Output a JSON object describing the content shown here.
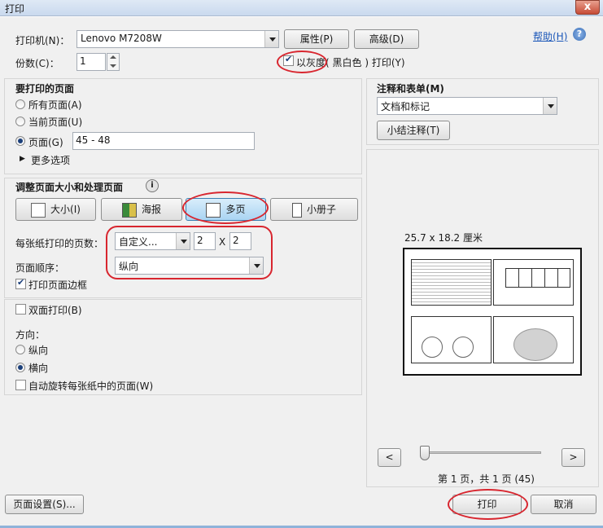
{
  "window": {
    "title": "打印",
    "close": "x"
  },
  "printer": {
    "printer_label": "打印机(N)：",
    "printer_value": "Lenovo M7208W",
    "properties_button": "属性(P)",
    "advanced_button": "高级(D)",
    "help_link": "帮助(H)",
    "copies_label": "份数(C)：",
    "copies_value": "1",
    "grayscale_prefix": "以灰度",
    "grayscale_suffix": "( 黑白色 ) 打印(Y)",
    "grayscale_checked": true
  },
  "pages_to_print": {
    "heading": "要打印的页面",
    "all_pages": "所有页面(A)",
    "current_page": "当前页面(U)",
    "pages": "页面(G)",
    "pages_value": "45 - 48",
    "more_options": "更多选项",
    "selected": "pages"
  },
  "sizing": {
    "heading": "调整页面大小和处理页面",
    "buttons": [
      "大小(I)",
      "海报",
      "多页",
      "小册子"
    ],
    "active": "多页",
    "pages_per_sheet_label": "每张纸打印的页数：",
    "pages_per_sheet_value": "自定义...",
    "cols_value": "2",
    "x_sep": "X",
    "rows_value": "2",
    "page_order_label": "页面顺序：",
    "page_order_value": "纵向",
    "print_border_label": "打印页面边框",
    "print_border_checked": true
  },
  "duplex": {
    "label": "双面打印(B)",
    "checked": false,
    "orientation_label": "方向：",
    "portrait": "纵向",
    "landscape": "横向",
    "selected": "landscape",
    "auto_rotate": "自动旋转每张纸中的页面(W)",
    "auto_rotate_checked": false
  },
  "comments": {
    "heading": "注释和表单(M)",
    "value": "文档和标记",
    "summarize_button": "小结注释(T)"
  },
  "preview": {
    "size_label": "25.7 x 18.2 厘米",
    "prev_button": "<",
    "next_button": ">",
    "page_status": "第 1 页，共 1 页 (45)",
    "slider_position": 0
  },
  "footer": {
    "page_setup_button": "页面设置(S)...",
    "print_button": "打印",
    "cancel_button": "取消"
  },
  "colors": {
    "highlight_circle": "#d8262f",
    "active_tab": "#bfe0f7",
    "link": "#1a56b8"
  }
}
